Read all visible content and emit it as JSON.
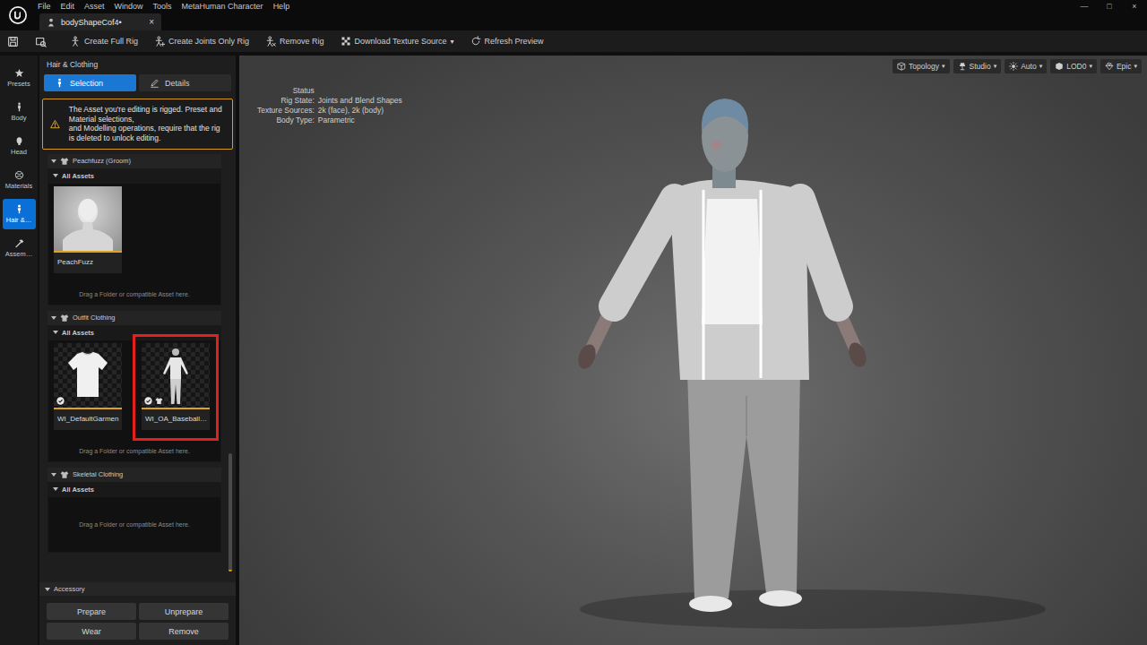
{
  "app": {
    "menu": [
      "File",
      "Edit",
      "Asset",
      "Window",
      "Tools",
      "MetaHuman Character",
      "Help"
    ],
    "window_controls": [
      "—",
      "□",
      "×"
    ]
  },
  "document_tab": {
    "label": "bodyShapeCof4•",
    "close": "×",
    "selected": true
  },
  "toolbar": [
    {
      "label": "Create Full Rig",
      "kind": "button"
    },
    {
      "label": "Create Joints Only Rig",
      "kind": "button"
    },
    {
      "label": "Remove Rig",
      "kind": "button"
    },
    {
      "label": "Download Texture Source",
      "kind": "dropdown",
      "arrow": "▾"
    },
    {
      "label": "Refresh Preview",
      "kind": "button"
    }
  ],
  "sidebar": {
    "items": [
      {
        "label": "Presets",
        "selected": false
      },
      {
        "label": "Body",
        "selected": false
      },
      {
        "label": "Head",
        "selected": false
      },
      {
        "label": "Materials",
        "selected": false
      },
      {
        "label": "Hair &…",
        "selected": true
      },
      {
        "label": "Assem…",
        "selected": false
      }
    ]
  },
  "panel": {
    "title": "Hair & Clothing",
    "tabs": [
      {
        "label": "Selection",
        "selected": true
      },
      {
        "label": "Details",
        "selected": false
      }
    ],
    "warning": [
      "The Asset you're editing is rigged. Preset and Material selections,",
      "and Modelling operations, require that the rig is deleted to unlock editing."
    ],
    "sections": [
      {
        "title": "Peachfuzz (Groom)",
        "expanded": true,
        "group": {
          "label": "All Assets",
          "expanded": true
        },
        "tiles": [
          {
            "label": "PeachFuzz",
            "kind": "groom",
            "checked": false,
            "highlighted": false
          }
        ],
        "hint": "Drag a Folder or compatible Asset here."
      },
      {
        "title": "Outfit Clothing",
        "expanded": true,
        "group": {
          "label": "All Assets",
          "expanded": true
        },
        "tiles": [
          {
            "label": "WI_DefaultGarmen",
            "kind": "shirt",
            "checked": true,
            "highlighted": false
          },
          {
            "label": "WI_OA_Baseball…",
            "kind": "outfit",
            "checked": true,
            "highlighted": true
          }
        ],
        "hint": "Drag a Folder or compatible Asset here."
      },
      {
        "title": "Skeletal Clothing",
        "expanded": true,
        "group": {
          "label": "All Assets",
          "expanded": true
        },
        "tiles": [],
        "hint": "Drag a Folder or compatible Asset here."
      }
    ],
    "accessory": {
      "title": "Accessory",
      "expanded": true,
      "buttons": [
        "Prepare",
        "Unprepare",
        "Wear",
        "Remove"
      ]
    }
  },
  "viewport": {
    "toolbar": [
      {
        "label": "Topology",
        "arrow": "▾"
      },
      {
        "label": "Studio",
        "arrow": "▾"
      },
      {
        "label": "Auto",
        "arrow": "▾"
      },
      {
        "label": "LOD0",
        "arrow": "▾"
      },
      {
        "label": "Epic",
        "arrow": "▾"
      }
    ],
    "status": {
      "title": "Status",
      "rows": [
        {
          "label": "Rig State:",
          "value": "Joints and Blend Shapes"
        },
        {
          "label": "Texture Sources:",
          "value": "2k (face), 2k (body)"
        },
        {
          "label": "Body Type:",
          "value": "Parametric"
        }
      ]
    }
  }
}
